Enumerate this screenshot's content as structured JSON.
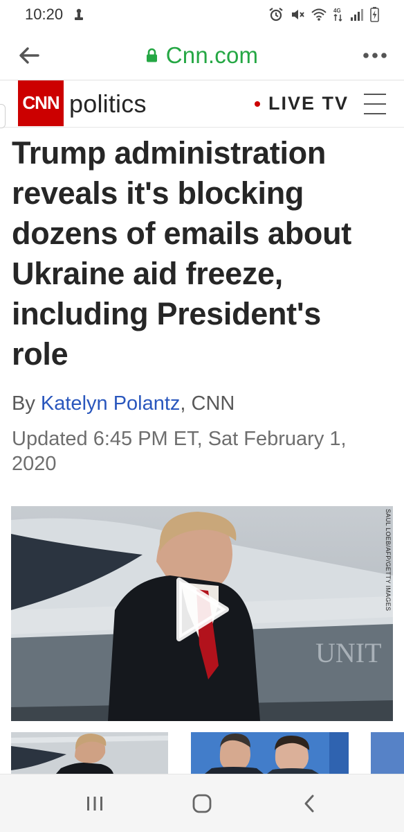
{
  "status_bar": {
    "time": "10:20",
    "icons": [
      "notification-person-icon",
      "alarm-icon",
      "mute-icon",
      "wifi-icon",
      "data-4g-icon",
      "signal-icon",
      "battery-charging-icon"
    ]
  },
  "browser": {
    "url": "Cnn.com",
    "secure": true,
    "accent_color": "#25a744"
  },
  "site_header": {
    "logo_text": "CNN",
    "section": "politics",
    "live_tv_label": "LIVE TV",
    "brand_color": "#cc0000"
  },
  "article": {
    "headline": "Trump administration reveals it's blocking dozens of emails about Ukraine aid freeze, including President's role",
    "byline_prefix": "By ",
    "author": "Katelyn Polantz",
    "byline_suffix": ", CNN",
    "updated": "Updated 6:45 PM ET, Sat February 1, 2020",
    "author_color": "#2a57bd"
  },
  "video": {
    "photo_credit": "SAUL LOEB/AFP/GETTY IMAGES",
    "play_icon": "play-icon"
  },
  "thumbnails": [
    {
      "name": "thumbnail-1"
    },
    {
      "name": "thumbnail-2"
    },
    {
      "name": "thumbnail-3"
    }
  ],
  "nav_bar": {
    "buttons": [
      "recent-apps-icon",
      "home-icon",
      "back-icon"
    ]
  }
}
